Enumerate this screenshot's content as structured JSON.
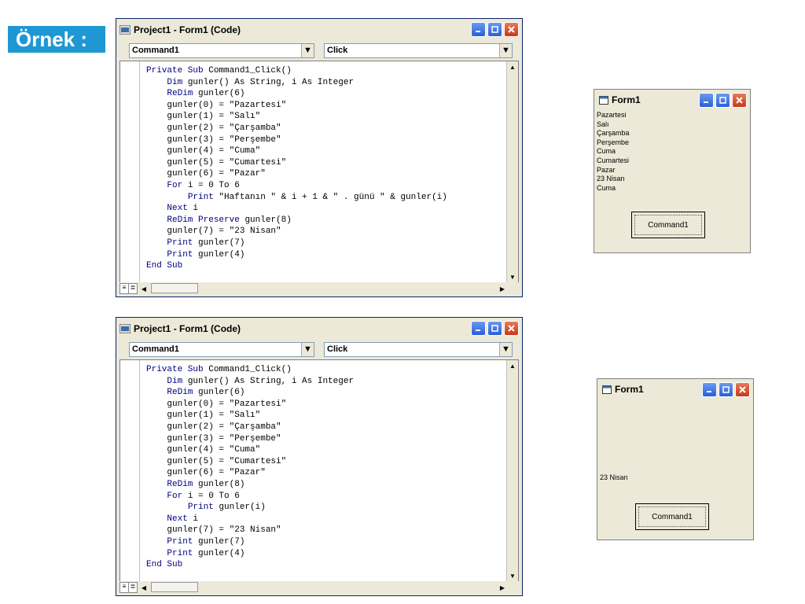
{
  "badge": "Örnek :",
  "windows": [
    {
      "title": "Project1 - Form1 (Code)",
      "object_combo": "Command1",
      "proc_combo": "Click",
      "code": [
        {
          "indent": 0,
          "kw": "Private Sub ",
          "text": "Command1_Click()"
        },
        {
          "indent": 1,
          "kw": "Dim ",
          "text": "gunler() As String, i As Integer"
        },
        {
          "indent": 1,
          "kw": "ReDim ",
          "text": "gunler(6)"
        },
        {
          "indent": 1,
          "kw": "",
          "text": "gunler(0) = \"Pazartesi\""
        },
        {
          "indent": 1,
          "kw": "",
          "text": "gunler(1) = \"Salı\""
        },
        {
          "indent": 1,
          "kw": "",
          "text": "gunler(2) = \"Çarşamba\""
        },
        {
          "indent": 1,
          "kw": "",
          "text": "gunler(3) = \"Perşembe\""
        },
        {
          "indent": 1,
          "kw": "",
          "text": "gunler(4) = \"Cuma\""
        },
        {
          "indent": 1,
          "kw": "",
          "text": "gunler(5) = \"Cumartesi\""
        },
        {
          "indent": 1,
          "kw": "",
          "text": "gunler(6) = \"Pazar\""
        },
        {
          "indent": 1,
          "kw": "For ",
          "text": "i = 0 To 6"
        },
        {
          "indent": 2,
          "kw": "Print ",
          "text": "\"Haftanın \" & i + 1 & \" . günü \" & gunler(i)"
        },
        {
          "indent": 1,
          "kw": "Next ",
          "text": "i"
        },
        {
          "indent": 1,
          "kw": "ReDim Preserve ",
          "text": "gunler(8)"
        },
        {
          "indent": 1,
          "kw": "",
          "text": "gunler(7) = \"23 Nisan\""
        },
        {
          "indent": 1,
          "kw": "Print ",
          "text": "gunler(7)"
        },
        {
          "indent": 1,
          "kw": "Print ",
          "text": "gunler(4)"
        },
        {
          "indent": 0,
          "kw": "End Sub",
          "text": ""
        }
      ]
    },
    {
      "title": "Project1 - Form1 (Code)",
      "object_combo": "Command1",
      "proc_combo": "Click",
      "code": [
        {
          "indent": 0,
          "kw": "Private Sub ",
          "text": "Command1_Click()"
        },
        {
          "indent": 1,
          "kw": "Dim ",
          "text": "gunler() As String, i As Integer"
        },
        {
          "indent": 1,
          "kw": "ReDim ",
          "text": "gunler(6)"
        },
        {
          "indent": 1,
          "kw": "",
          "text": "gunler(0) = \"Pazartesi\""
        },
        {
          "indent": 1,
          "kw": "",
          "text": "gunler(1) = \"Salı\""
        },
        {
          "indent": 1,
          "kw": "",
          "text": "gunler(2) = \"Çarşamba\""
        },
        {
          "indent": 1,
          "kw": "",
          "text": "gunler(3) = \"Perşembe\""
        },
        {
          "indent": 1,
          "kw": "",
          "text": "gunler(4) = \"Cuma\""
        },
        {
          "indent": 1,
          "kw": "",
          "text": "gunler(5) = \"Cumartesi\""
        },
        {
          "indent": 1,
          "kw": "",
          "text": "gunler(6) = \"Pazar\""
        },
        {
          "indent": 1,
          "kw": "ReDim ",
          "text": "gunler(8)"
        },
        {
          "indent": 1,
          "kw": "For ",
          "text": "i = 0 To 6"
        },
        {
          "indent": 2,
          "kw": "Print ",
          "text": "gunler(i)"
        },
        {
          "indent": 1,
          "kw": "Next ",
          "text": "i"
        },
        {
          "indent": 1,
          "kw": "",
          "text": "gunler(7) = \"23 Nisan\""
        },
        {
          "indent": 1,
          "kw": "Print ",
          "text": "gunler(7)"
        },
        {
          "indent": 1,
          "kw": "Print ",
          "text": "gunler(4)"
        },
        {
          "indent": 0,
          "kw": "End Sub",
          "text": ""
        }
      ]
    }
  ],
  "forms": [
    {
      "title": "Form1",
      "output_lines": [
        "Pazartesi",
        "Salı",
        "Çarşamba",
        "Perşembe",
        "Cuma",
        "Cumartesi",
        "Pazar",
        "23 Nisan",
        "Cuma"
      ],
      "button_label": "Command1"
    },
    {
      "title": "Form1",
      "output_lines": [
        "",
        "",
        "",
        "",
        "",
        "",
        "",
        "",
        "23 Nisan",
        ""
      ],
      "button_label": "Command1"
    }
  ],
  "colors": {
    "badge_bg": "#1f97d3",
    "keyword": "#00007f"
  }
}
